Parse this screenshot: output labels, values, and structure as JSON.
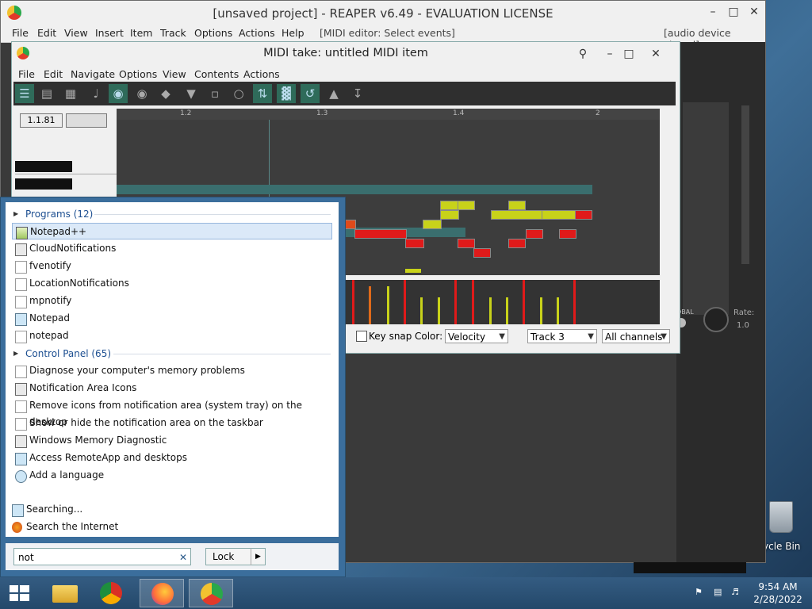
{
  "reaper": {
    "title": "[unsaved project] - REAPER v6.49 - EVALUATION LICENSE",
    "menu": [
      "File",
      "Edit",
      "View",
      "Insert",
      "Item",
      "Track",
      "Options",
      "Actions",
      "Help",
      "[MIDI editor: Select events]"
    ],
    "status_right": "[audio device closed]"
  },
  "midi": {
    "title": "MIDI take: untitled MIDI item",
    "menu": [
      "File",
      "Edit",
      "Navigate",
      "Options",
      "View",
      "Contents",
      "Actions"
    ],
    "position": "1.1.81",
    "ruler": [
      "1.2",
      "1.3",
      "1.4",
      "2"
    ],
    "key_snap": "Key snap",
    "color_label": "Color:",
    "color_value": "Velocity",
    "track_value": "Track 3",
    "channels_value": "All channels"
  },
  "side": {
    "global": "OBAL",
    "rate": "Rate:",
    "rate_value": "1.0"
  },
  "start": {
    "programs_header": "Programs (12)",
    "programs": [
      {
        "label": "Notepad++",
        "icon": "notepadpp-icon",
        "selected": true
      },
      {
        "label": "CloudNotifications",
        "icon": "app-icon"
      },
      {
        "label": "fvenotify",
        "icon": "file-icon"
      },
      {
        "label": "LocationNotifications",
        "icon": "file-icon"
      },
      {
        "label": "mpnotify",
        "icon": "file-icon"
      },
      {
        "label": "Notepad",
        "icon": "notepad-icon"
      },
      {
        "label": "notepad",
        "icon": "file-icon"
      }
    ],
    "control_header": "Control Panel (65)",
    "control": [
      {
        "label": "Diagnose your computer's memory problems",
        "icon": "file-icon"
      },
      {
        "label": "Notification Area Icons",
        "icon": "monitor-icon"
      },
      {
        "label": "Remove icons from notification area (system tray) on the desktop",
        "icon": "file-icon"
      },
      {
        "label": "Show or hide the notification area on the taskbar",
        "icon": "file-icon"
      },
      {
        "label": "Windows Memory Diagnostic",
        "icon": "memory-icon"
      },
      {
        "label": "Access RemoteApp and desktops",
        "icon": "remote-icon"
      },
      {
        "label": "Add a language",
        "icon": "language-icon"
      }
    ],
    "searching": "Searching...",
    "search_internet": "Search the Internet",
    "search_value": "not",
    "lock_label": "Lock"
  },
  "desktop": {
    "recycle_label": "ycle Bin"
  },
  "taskbar": {
    "time": "9:54 AM",
    "date": "2/28/2022"
  }
}
